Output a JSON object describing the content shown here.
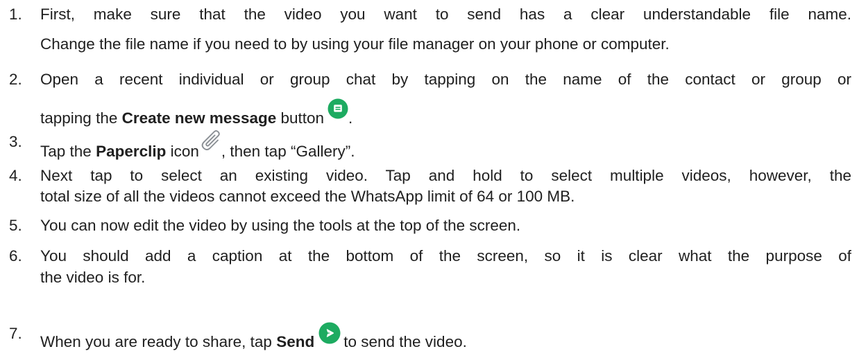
{
  "steps": [
    {
      "number": "1.",
      "lines": [
        "First, make sure that the video you want to send has a clear understandable file name.",
        "Change the file name if you need to by using your file manager on your phone or computer."
      ]
    },
    {
      "number": "2.",
      "line1": "Open a recent individual or group chat by tapping on the name of the contact or group or",
      "pre": "tapping the ",
      "bold": "Create new message",
      "post": " button",
      "after_icon": ".",
      "icon": "create-message-icon"
    },
    {
      "number": "3.",
      "pre": "Tap the ",
      "bold": "Paperclip",
      "post": " icon",
      "after_icon": ", then tap “Gallery”.",
      "icon": "paperclip-icon"
    },
    {
      "number": "4.",
      "lines": [
        "Next tap to select an existing video. Tap and hold to select multiple videos, however, the",
        "total size of all the videos cannot exceed the WhatsApp limit of 64 or 100 MB."
      ]
    },
    {
      "number": "5.",
      "lines": [
        "You can now edit the video by using the tools at the top of the screen."
      ]
    },
    {
      "number": "6.",
      "lines": [
        "You should add a caption at the bottom of the screen, so it is clear what the purpose of",
        "the video is for."
      ]
    },
    {
      "number": "7.",
      "pre": "When you are ready to share, tap ",
      "bold": "Send",
      "after_icon": "to send the video.",
      "icon": "send-icon"
    }
  ],
  "colors": {
    "text": "#1f1f1f",
    "whatsapp_green": "#1dab61",
    "icon_white": "#ffffff",
    "paperclip_gray": "#8a8f94"
  }
}
